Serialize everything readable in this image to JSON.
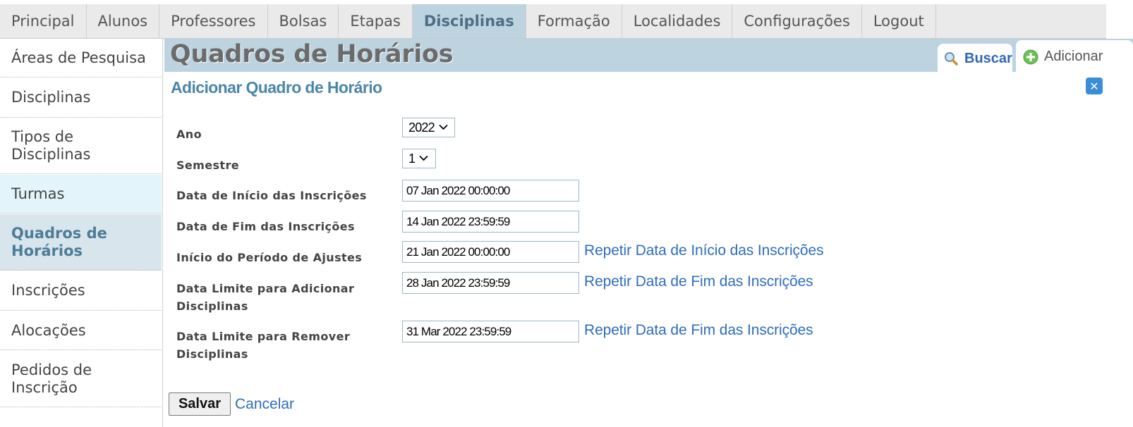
{
  "nav": {
    "items": [
      {
        "label": "Principal"
      },
      {
        "label": "Alunos"
      },
      {
        "label": "Professores"
      },
      {
        "label": "Bolsas"
      },
      {
        "label": "Etapas"
      },
      {
        "label": "Disciplinas",
        "active": true
      },
      {
        "label": "Formação"
      },
      {
        "label": "Localidades"
      },
      {
        "label": "Configurações"
      },
      {
        "label": "Logout"
      }
    ]
  },
  "sidebar": {
    "items": [
      {
        "label": "Áreas de Pesquisa"
      },
      {
        "label": "Disciplinas"
      },
      {
        "label": "Tipos de Disciplinas"
      },
      {
        "label": "Turmas",
        "state": "hover"
      },
      {
        "label": "Quadros de Horários",
        "state": "active"
      },
      {
        "label": "Inscrições"
      },
      {
        "label": "Alocações"
      },
      {
        "label": "Pedidos de Inscrição"
      }
    ]
  },
  "header": {
    "title": "Quadros de Horários",
    "tabs": {
      "search": "Buscar",
      "add": "Adicionar"
    }
  },
  "form": {
    "title": "Adicionar Quadro de Horário",
    "fields": {
      "ano": {
        "label": "Ano",
        "value": "2022"
      },
      "semestre": {
        "label": "Semestre",
        "value": "1"
      },
      "inicio_inscricoes": {
        "label": "Data de Início das Inscrições",
        "value": "07 Jan 2022 00:00:00"
      },
      "fim_inscricoes": {
        "label": "Data de Fim das Inscrições",
        "value": "14 Jan 2022 23:59:59"
      },
      "inicio_ajustes": {
        "label": "Início do Período de Ajustes",
        "value": "21 Jan 2022 00:00:00",
        "link": "Repetir Data de Início das Inscrições"
      },
      "limite_adicionar": {
        "label": "Data Limite para Adicionar Disciplinas",
        "value": "28 Jan 2022 23:59:59",
        "link": "Repetir Data de Fim das Inscrições"
      },
      "limite_remover": {
        "label": "Data Limite para Remover Disciplinas",
        "value": "31 Mar 2022 23:59:59",
        "link": "Repetir Data de Fim das Inscrições"
      }
    },
    "actions": {
      "save": "Salvar",
      "cancel": "Cancelar"
    }
  },
  "colors": {
    "accent": "#bdd3e0",
    "link": "#2e6dbd",
    "section_title": "#4a86a8",
    "close_button": "#3a8ed8"
  },
  "icons": {
    "search": "magnifier-icon",
    "add": "plus-circle-icon",
    "close": "close-icon"
  }
}
